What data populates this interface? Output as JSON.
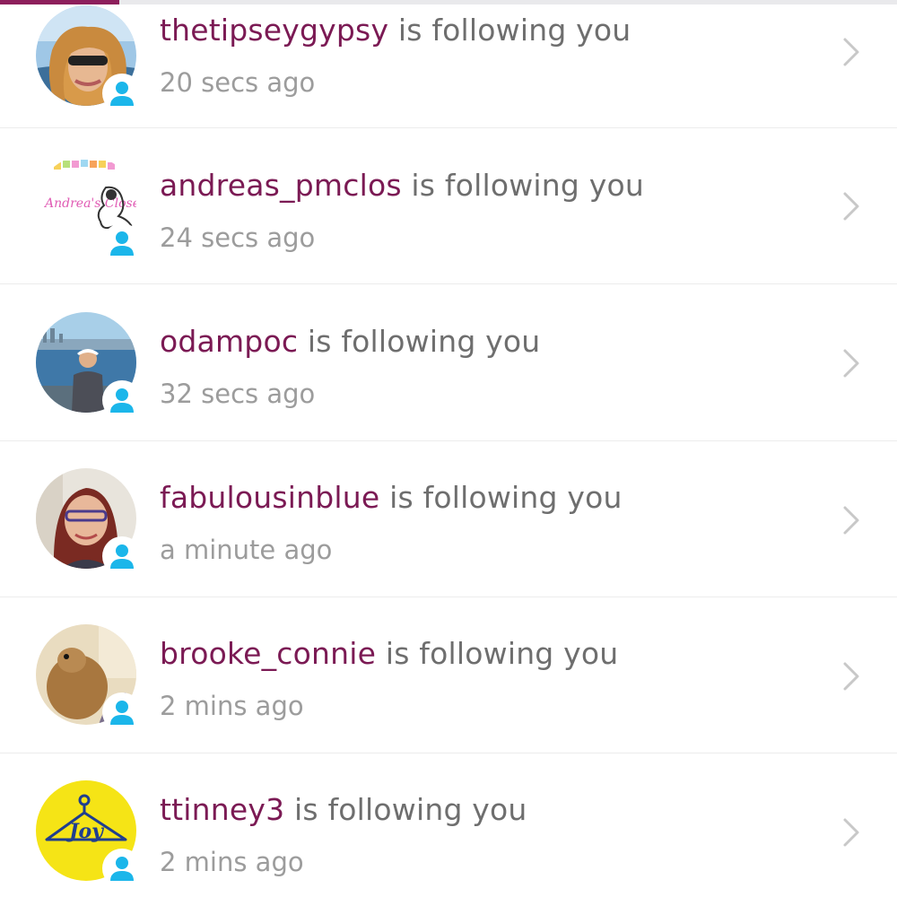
{
  "colors": {
    "username": "#7b1a54",
    "action_text": "#6e6e6e",
    "timestamp": "#9c9c9c",
    "follow_badge": "#1bb6ea",
    "tab_indicator": "#8d1f5c",
    "chevron": "#c8c8c8"
  },
  "icons": {
    "follow_badge": "person-icon",
    "row_action": "chevron-right-icon"
  },
  "notifications": [
    {
      "username": "thetipseygypsy",
      "action": " is following you",
      "time": "20 secs ago"
    },
    {
      "username": "andreas_pmclos",
      "action": " is following you",
      "time": "24 secs ago"
    },
    {
      "username": "odampoc",
      "action": " is following you",
      "time": "32 secs ago"
    },
    {
      "username": "fabulousinblue",
      "action": " is following you",
      "time": "a minute ago"
    },
    {
      "username": "brooke_connie",
      "action": " is following you",
      "time": "2 mins ago"
    },
    {
      "username": "ttinney3",
      "action": " is following you",
      "time": "2 mins ago"
    }
  ],
  "avatars": {
    "andreas_logo_text": "Andrea's Closet",
    "joy_logo_text": "Joy"
  }
}
